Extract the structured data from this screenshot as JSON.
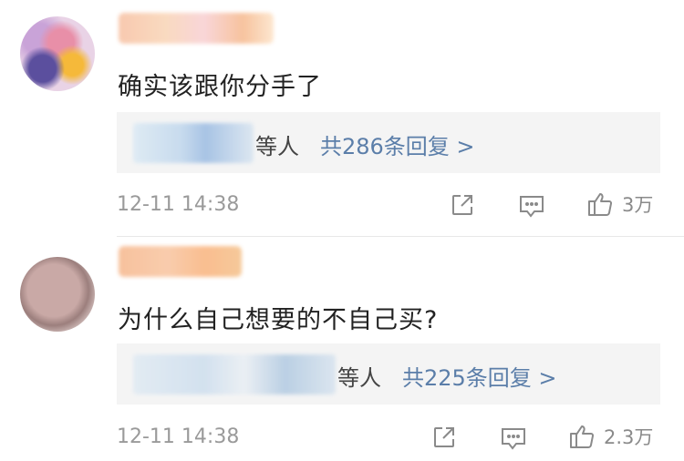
{
  "comments": [
    {
      "text": "确实该跟你分手了",
      "reply_who": "等人",
      "reply_count": "共286条回复 >",
      "time": "12-11 14:38",
      "likes": "3万"
    },
    {
      "text": "为什么自己想要的不自己买?",
      "reply_who": "等人",
      "reply_count": "共225条回复 >",
      "time": "12-11 14:38",
      "likes": "2.3万"
    }
  ],
  "icons": {
    "share": "share-icon",
    "comment": "comment-icon",
    "like": "thumbs-up-icon"
  },
  "colors": {
    "link": "#5b7ea9",
    "meta": "#9a9a9a",
    "reply_bg": "#f4f4f4"
  }
}
